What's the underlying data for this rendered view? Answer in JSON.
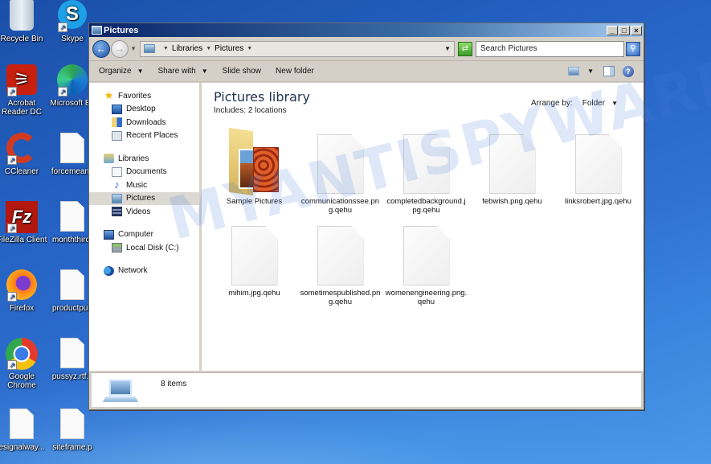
{
  "desktop": {
    "icons": [
      {
        "label": "Recycle Bin",
        "type": "recycle-bin",
        "shortcut": false
      },
      {
        "label": "Skype",
        "type": "skype",
        "shortcut": true
      },
      {
        "label": "Acrobat Reader DC",
        "type": "acrobat",
        "shortcut": true
      },
      {
        "label": "Microsoft Ec",
        "type": "edge",
        "shortcut": true
      },
      {
        "label": "CCleaner",
        "type": "ccleaner",
        "shortcut": true
      },
      {
        "label": "forcemeans",
        "type": "document",
        "shortcut": false
      },
      {
        "label": "FileZilla Client",
        "type": "filezilla",
        "shortcut": true
      },
      {
        "label": "monththird.",
        "type": "document",
        "shortcut": false
      },
      {
        "label": "Firefox",
        "type": "firefox",
        "shortcut": true
      },
      {
        "label": "productpub",
        "type": "document",
        "shortcut": false
      },
      {
        "label": "Google Chrome",
        "type": "chrome",
        "shortcut": true
      },
      {
        "label": "pussyz.rtf.c",
        "type": "document",
        "shortcut": false
      },
      {
        "label": "esignalway...",
        "type": "document",
        "shortcut": false
      },
      {
        "label": "siteframe.p",
        "type": "document",
        "shortcut": false
      }
    ]
  },
  "window": {
    "title": "Pictures",
    "controls": {
      "minimize": "_",
      "maximize": "□",
      "close": "×"
    },
    "address": {
      "breadcrumbs": [
        "Libraries",
        "Pictures"
      ],
      "search_placeholder": "Search Pictures"
    },
    "commands": {
      "organize": "Organize",
      "share_with": "Share with",
      "slide_show": "Slide show",
      "new_folder": "New folder"
    },
    "nav_pane": {
      "favorites": {
        "label": "Favorites",
        "items": [
          "Desktop",
          "Downloads",
          "Recent Places"
        ]
      },
      "libraries": {
        "label": "Libraries",
        "items": [
          "Documents",
          "Music",
          "Pictures",
          "Videos"
        ],
        "selected": "Pictures"
      },
      "computer": {
        "label": "Computer",
        "items": [
          "Local Disk (C:)"
        ]
      },
      "network": {
        "label": "Network"
      }
    },
    "content": {
      "title": "Pictures library",
      "includes_label": "Includes:",
      "includes_value": "2 locations",
      "arrange_label": "Arrange by:",
      "arrange_value": "Folder",
      "files": [
        {
          "name": "Sample Pictures",
          "type": "folder"
        },
        {
          "name": "communicationssee.png.qehu",
          "type": "file"
        },
        {
          "name": "completedbackground.jpg.qehu",
          "type": "file"
        },
        {
          "name": "febwish.png.qehu",
          "type": "file"
        },
        {
          "name": "linksrobert.jpg.qehu",
          "type": "file"
        },
        {
          "name": "mihim.jpg.qehu",
          "type": "file"
        },
        {
          "name": "sometimespublished.png.qehu",
          "type": "file"
        },
        {
          "name": "womenengineering.png.qehu",
          "type": "file"
        }
      ]
    },
    "status": {
      "item_count": "8 items"
    }
  },
  "watermark": "MYANTISPYWARE.COM"
}
